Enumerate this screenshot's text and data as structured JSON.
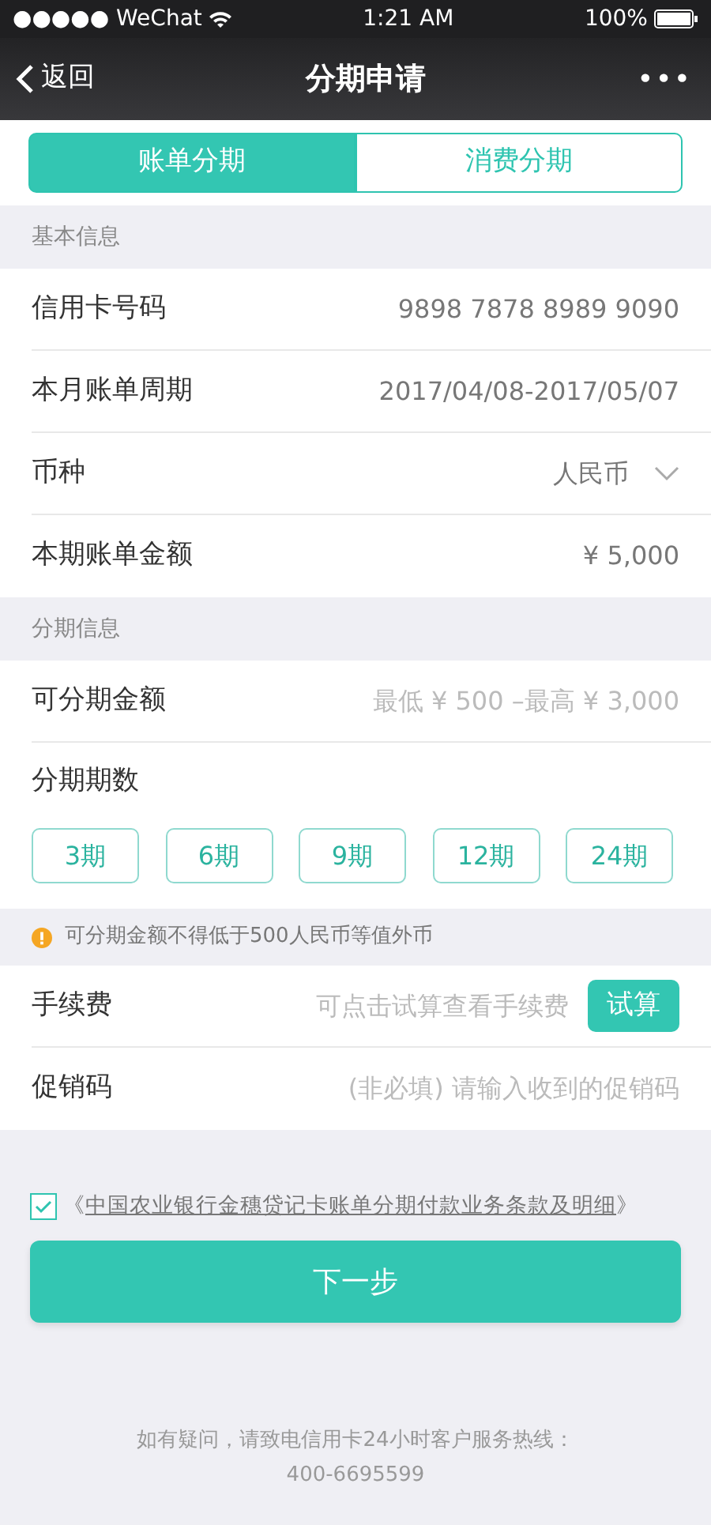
{
  "status_bar": {
    "carrier": "●●●●● WeChat",
    "time": "1:21 AM",
    "battery": "100%"
  },
  "nav": {
    "back": "返回",
    "title": "分期申请",
    "more": "•••"
  },
  "tabs": [
    {
      "label": "账单分期",
      "selected": true
    },
    {
      "label": "消费分期",
      "selected": false
    }
  ],
  "basic_section": {
    "heading": "基本信息",
    "rows": [
      {
        "kind": "value",
        "label": "信用卡号码",
        "value": "9898 7878 8989 9090"
      },
      {
        "kind": "value",
        "label": "本月账单周期",
        "value": "2017/04/08-2017/05/07"
      },
      {
        "kind": "select",
        "label": "币种",
        "value": "人民币"
      },
      {
        "kind": "value",
        "label": "本期账单金额",
        "value": "¥ 5,000"
      }
    ]
  },
  "installment_section": {
    "heading": "分期信息",
    "amount": {
      "label": "可分期金额",
      "placeholder": "最低 ¥ 500 –最高 ¥ 3,000"
    },
    "periods_label": "分期期数",
    "periods": [
      {
        "label": "3期",
        "selected": false
      },
      {
        "label": "6期",
        "selected": false
      },
      {
        "label": "9期",
        "selected": false
      },
      {
        "label": "12期",
        "selected": false
      },
      {
        "label": "24期",
        "selected": false
      }
    ],
    "notice": "可分期金额不得低于500人民币等值外币"
  },
  "fee": {
    "label": "手续费",
    "hint": "可点击试算查看手续费",
    "button": "试算"
  },
  "promo": {
    "label": "促销码",
    "placeholder": "(非必填) 请输入收到的促销码"
  },
  "agreement": {
    "checked": true,
    "open": "《",
    "link": "中国农业银行金穗贷记卡账单分期付款业务条款及明细",
    "close": "》"
  },
  "next_button": "下一步",
  "footer": {
    "text": "如有疑问，请致电信用卡24小时客户服务热线：",
    "phone": "400-6695599"
  }
}
